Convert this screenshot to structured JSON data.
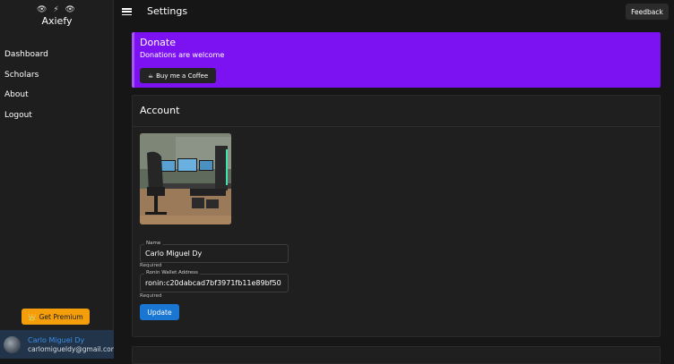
{
  "app": {
    "brand_icons": "👁 ⚡ 👁",
    "name": "Axiefy"
  },
  "sidebar": {
    "items": [
      {
        "label": "Dashboard"
      },
      {
        "label": "Scholars"
      },
      {
        "label": "About"
      },
      {
        "label": "Logout"
      }
    ],
    "premium_label": "Get Premium",
    "user": {
      "name": "Carlo Miguel Dy",
      "email": "carlomigueldy@gmail.com"
    }
  },
  "header": {
    "title": "Settings",
    "feedback_label": "Feedback"
  },
  "donate": {
    "title": "Donate",
    "subtitle": "Donations are welcome",
    "button_label": "Buy me a Coffee"
  },
  "account": {
    "title": "Account",
    "name_field": {
      "label": "Name",
      "value": "Carlo Miguel Dy",
      "helper": "Required"
    },
    "wallet_field": {
      "label": "Ronin Wallet Address",
      "value": "ronin:c20dabcad7bf3971fb11e89bf50",
      "helper": "Required"
    },
    "update_label": "Update"
  },
  "colors": {
    "donate_bg": "#7c12f2",
    "premium": "#f59e0b",
    "primary": "#1976d2"
  }
}
